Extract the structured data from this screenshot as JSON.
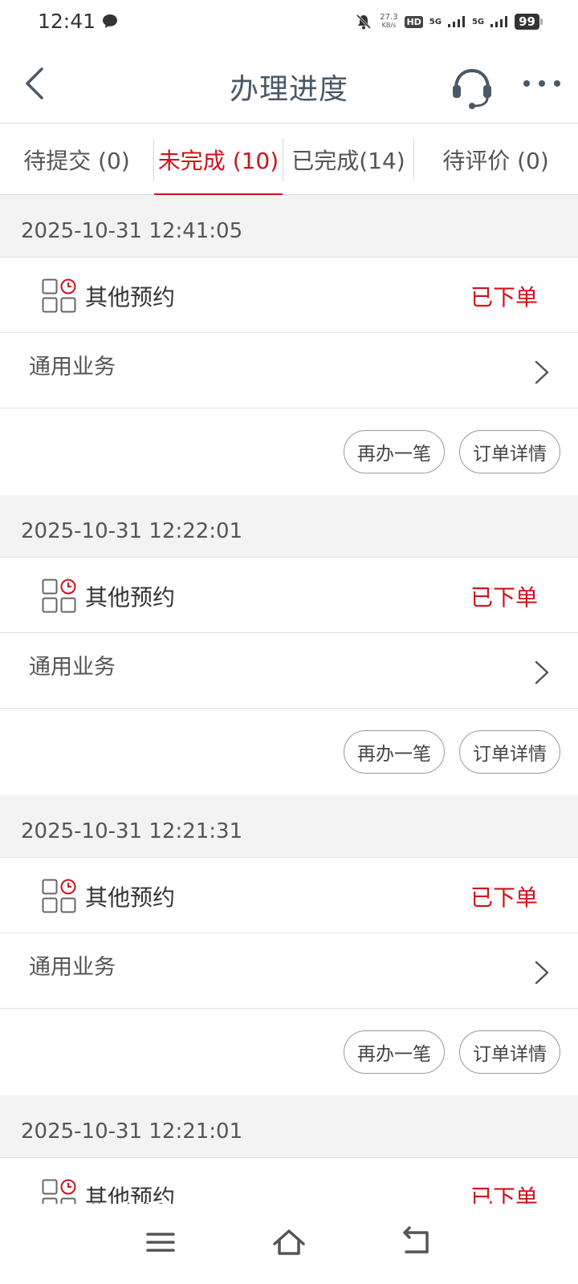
{
  "status_bar": {
    "time": "12:41",
    "net_speed_value": "27.3",
    "net_speed_unit": "KB/s",
    "hd_badge": "HD",
    "sim1_label": "5G",
    "sim2_label": "5G",
    "battery": "99"
  },
  "header": {
    "title": "办理进度"
  },
  "tabs": [
    {
      "label": "待提交 (0)",
      "active": false
    },
    {
      "label": "未完成 (10)",
      "active": true
    },
    {
      "label": "已完成(14)",
      "active": false
    },
    {
      "label": "待评价 (0)",
      "active": false
    }
  ],
  "orders": [
    {
      "datetime": "2025-10-31 12:41:05",
      "type": "其他预约",
      "status": "已下单",
      "business": "通用业务",
      "btn_again": "再办一笔",
      "btn_detail": "订单详情"
    },
    {
      "datetime": "2025-10-31 12:22:01",
      "type": "其他预约",
      "status": "已下单",
      "business": "通用业务",
      "btn_again": "再办一笔",
      "btn_detail": "订单详情"
    },
    {
      "datetime": "2025-10-31 12:21:31",
      "type": "其他预约",
      "status": "已下单",
      "business": "通用业务",
      "btn_again": "再办一笔",
      "btn_detail": "订单详情"
    },
    {
      "datetime": "2025-10-31 12:21:01",
      "type": "其他预约",
      "status": "已下单"
    }
  ],
  "colors": {
    "accent": "#d0121b",
    "title": "#4a5866",
    "section_bg": "#f3f3f3"
  },
  "icons": {
    "back": "chevron-left-icon",
    "service": "headset-icon",
    "more": "more-dots-icon",
    "appointment": "appointment-grid-clock-icon",
    "chevron": "chevron-right-icon",
    "nav_menu": "menu-icon",
    "nav_home": "home-icon",
    "nav_back": "back-arrow-icon"
  }
}
